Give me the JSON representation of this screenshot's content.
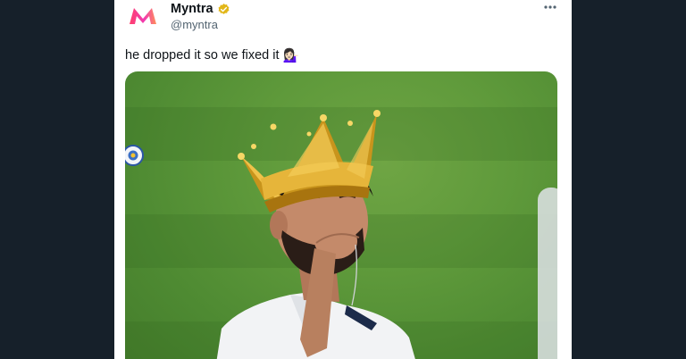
{
  "author": {
    "name": "Myntra",
    "handle": "@myntra",
    "verified": true,
    "logo_letter": "M",
    "brand_colors": [
      "#ff3f6c",
      "#f13ab1",
      "#ff905a"
    ]
  },
  "menu": {
    "more_icon": "more-horizontal-icon",
    "more_label": "···"
  },
  "tweet": {
    "text": "he dropped it so we fixed it",
    "emoji": "💁🏻‍♀️"
  },
  "media": {
    "description_icon": "crown-icon",
    "badge_icon": "bcci-badge-icon"
  },
  "colors": {
    "background": "#15202b",
    "card": "#ffffff",
    "text": "#0f1419",
    "muted": "#536471",
    "verified": "#e2b719"
  }
}
